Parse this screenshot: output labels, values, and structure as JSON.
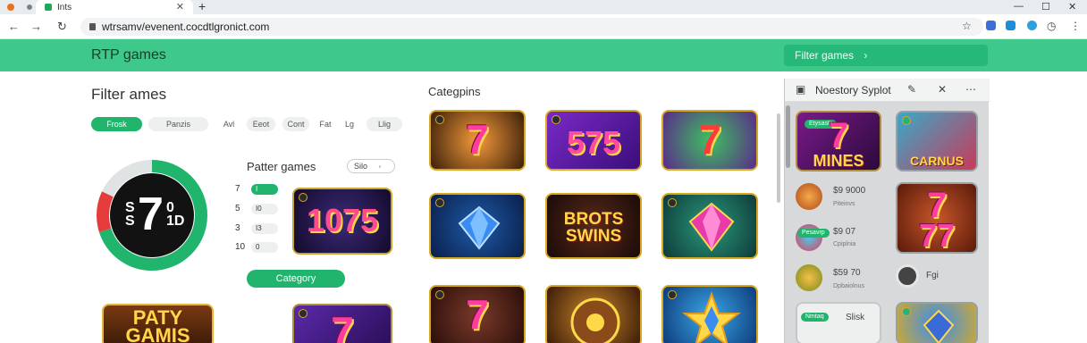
{
  "browser": {
    "tab_title": "Ints",
    "url": "wtrsamv/evenent.cocdtlgronict.com"
  },
  "header": {
    "title": "RTP games",
    "filter_button": "Filter games",
    "filter_arrow": "›"
  },
  "filters": {
    "title": "Filter ames",
    "chips": [
      "Frosk",
      "Panzis",
      "Avl",
      "Eeot",
      "Cont",
      "Fat",
      "Lg",
      "Llig"
    ]
  },
  "popular": {
    "title": "Patter games",
    "sort_label": "Silo",
    "donut": {
      "big_digit": "7",
      "left_line1": "S",
      "left_line2": "S",
      "right_line1": "0",
      "right_line2": "1D",
      "green_fraction": 0.7,
      "red_fraction": 0.12
    },
    "rows": [
      {
        "num": "7",
        "bar": "I",
        "active": true
      },
      {
        "num": "5",
        "bar": "I0",
        "active": false
      },
      {
        "num": "3",
        "bar": "I3",
        "active": false
      },
      {
        "num": "10",
        "bar": "0",
        "active": false
      }
    ],
    "featured_tile": "1075",
    "category_button": "Category"
  },
  "bottom_tile": {
    "line1": "PATY",
    "line2": "GAMIS"
  },
  "categories": {
    "title": "Categpins",
    "tiles": [
      "7",
      "575",
      "7",
      "diamond",
      "BROTS SWINS",
      "gem",
      "7",
      "wheel",
      "star"
    ]
  },
  "history": {
    "title": "Noestory Syplot",
    "tiles": [
      {
        "label": "MINES",
        "badge": "Etysasts"
      },
      {
        "label": "CARNUS",
        "badge": ""
      }
    ],
    "rows": [
      {
        "price": "$9 9000",
        "sub": "Piteinvs",
        "badge": ""
      },
      {
        "price": "$9 07",
        "sub": "Cpiplnia",
        "badge": "Pesavrp"
      },
      {
        "price": "$59 70",
        "sub": "Dpbaiolnus",
        "badge": ""
      }
    ],
    "side_item": "Fgi",
    "bottom_badge": "Nmtaq",
    "bottom_label": "Slisk"
  },
  "colors": {
    "brand_green": "#3ec98a",
    "accent_green": "#20b46d"
  }
}
